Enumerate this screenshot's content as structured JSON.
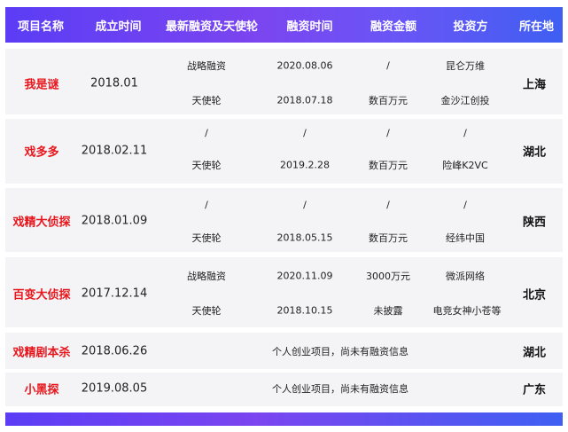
{
  "header": {
    "project": "项目名称",
    "founded": "成立时间",
    "latest_round": "最新融资及天使轮",
    "funding_time": "融资时间",
    "amount": "融资金额",
    "investor": "投资方",
    "location": "所在地"
  },
  "rows": [
    {
      "name": "我是谜",
      "founded": "2018.01",
      "location": "上海",
      "lines": [
        {
          "round": "战略融资",
          "time": "2020.08.06",
          "amount": "/",
          "investor": "昆仑万维"
        },
        {
          "round": "天使轮",
          "time": "2018.07.18",
          "amount": "数百万元",
          "investor": "金沙江创投"
        }
      ]
    },
    {
      "name": "戏多多",
      "founded": "2018.02.11",
      "location": "湖北",
      "lines": [
        {
          "round": "/",
          "time": "/",
          "amount": "/",
          "investor": "/"
        },
        {
          "round": "天使轮",
          "time": "2019.2.28",
          "amount": "数百万元",
          "investor": "险峰K2VC"
        }
      ]
    },
    {
      "name": "戏精大侦探",
      "founded": "2018.01.09",
      "location": "陕西",
      "lines": [
        {
          "round": "/",
          "time": "/",
          "amount": "/",
          "investor": "/"
        },
        {
          "round": "天使轮",
          "time": "2018.05.15",
          "amount": "数百万元",
          "investor": "经纬中国"
        }
      ]
    },
    {
      "name": "百变大侦探",
      "founded": "2017.12.14",
      "location": "北京",
      "lines": [
        {
          "round": "战略融资",
          "time": "2020.11.09",
          "amount": "3000万元",
          "investor": "微派网络"
        },
        {
          "round": "天使轮",
          "time": "2018.10.15",
          "amount": "未披露",
          "investor": "电竞女神小苍等"
        }
      ]
    },
    {
      "name": "戏精剧本杀",
      "founded": "2018.06.26",
      "location": "湖北",
      "note": "个人创业项目，尚未有融资信息"
    },
    {
      "name": "小黑探",
      "founded": "2019.08.05",
      "location": "广东",
      "note": "个人创业项目，尚未有融资信息"
    }
  ]
}
